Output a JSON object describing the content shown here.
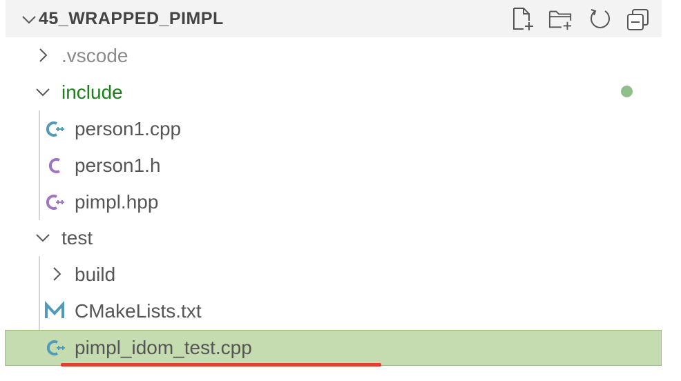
{
  "explorer": {
    "title": "45_WRAPPED_PIMPL",
    "actions": [
      {
        "name": "new-file-icon"
      },
      {
        "name": "new-folder-icon"
      },
      {
        "name": "refresh-icon"
      },
      {
        "name": "collapse-all-icon"
      }
    ],
    "tree": {
      "vscode": ".vscode",
      "include": "include",
      "person1_cpp": "person1.cpp",
      "person1_h": "person1.h",
      "pimpl_hpp": "pimpl.hpp",
      "test": "test",
      "build": "build",
      "cmakelists": "CMakeLists.txt",
      "pimpl_idom_test": "pimpl_idom_test.cpp"
    },
    "colors": {
      "header_bg": "#f3f3f3",
      "modified_folder": "#1a7f1a",
      "dimmed_text": "#8a8a8a",
      "text": "#555555",
      "cpp_icon": "#519aba",
      "cpp_icon_purple": "#a074c4",
      "h_icon": "#a074c4",
      "markdown_icon": "#519aba",
      "selected_bg": "#c5dbb0",
      "modified_dot": "#8fbf8a",
      "error_squiggle": "#e2402f"
    }
  }
}
